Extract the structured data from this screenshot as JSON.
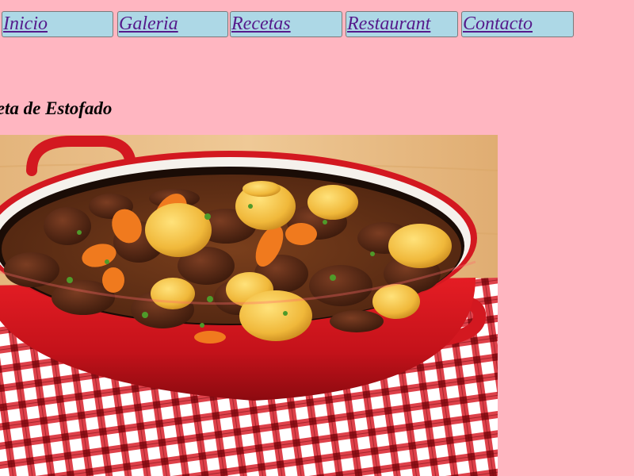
{
  "nav": {
    "items": [
      {
        "label": "Inicio"
      },
      {
        "label": "Galeria"
      },
      {
        "label": "Recetas"
      },
      {
        "label": "Restaurant"
      },
      {
        "label": "Contacto"
      }
    ]
  },
  "main": {
    "title": "Receta de Estofado",
    "image": {
      "alt": "Estofado"
    }
  },
  "colors": {
    "page_background": "#ffb6c1",
    "nav_background": "#add8e6",
    "link_color": "#551a8b"
  }
}
